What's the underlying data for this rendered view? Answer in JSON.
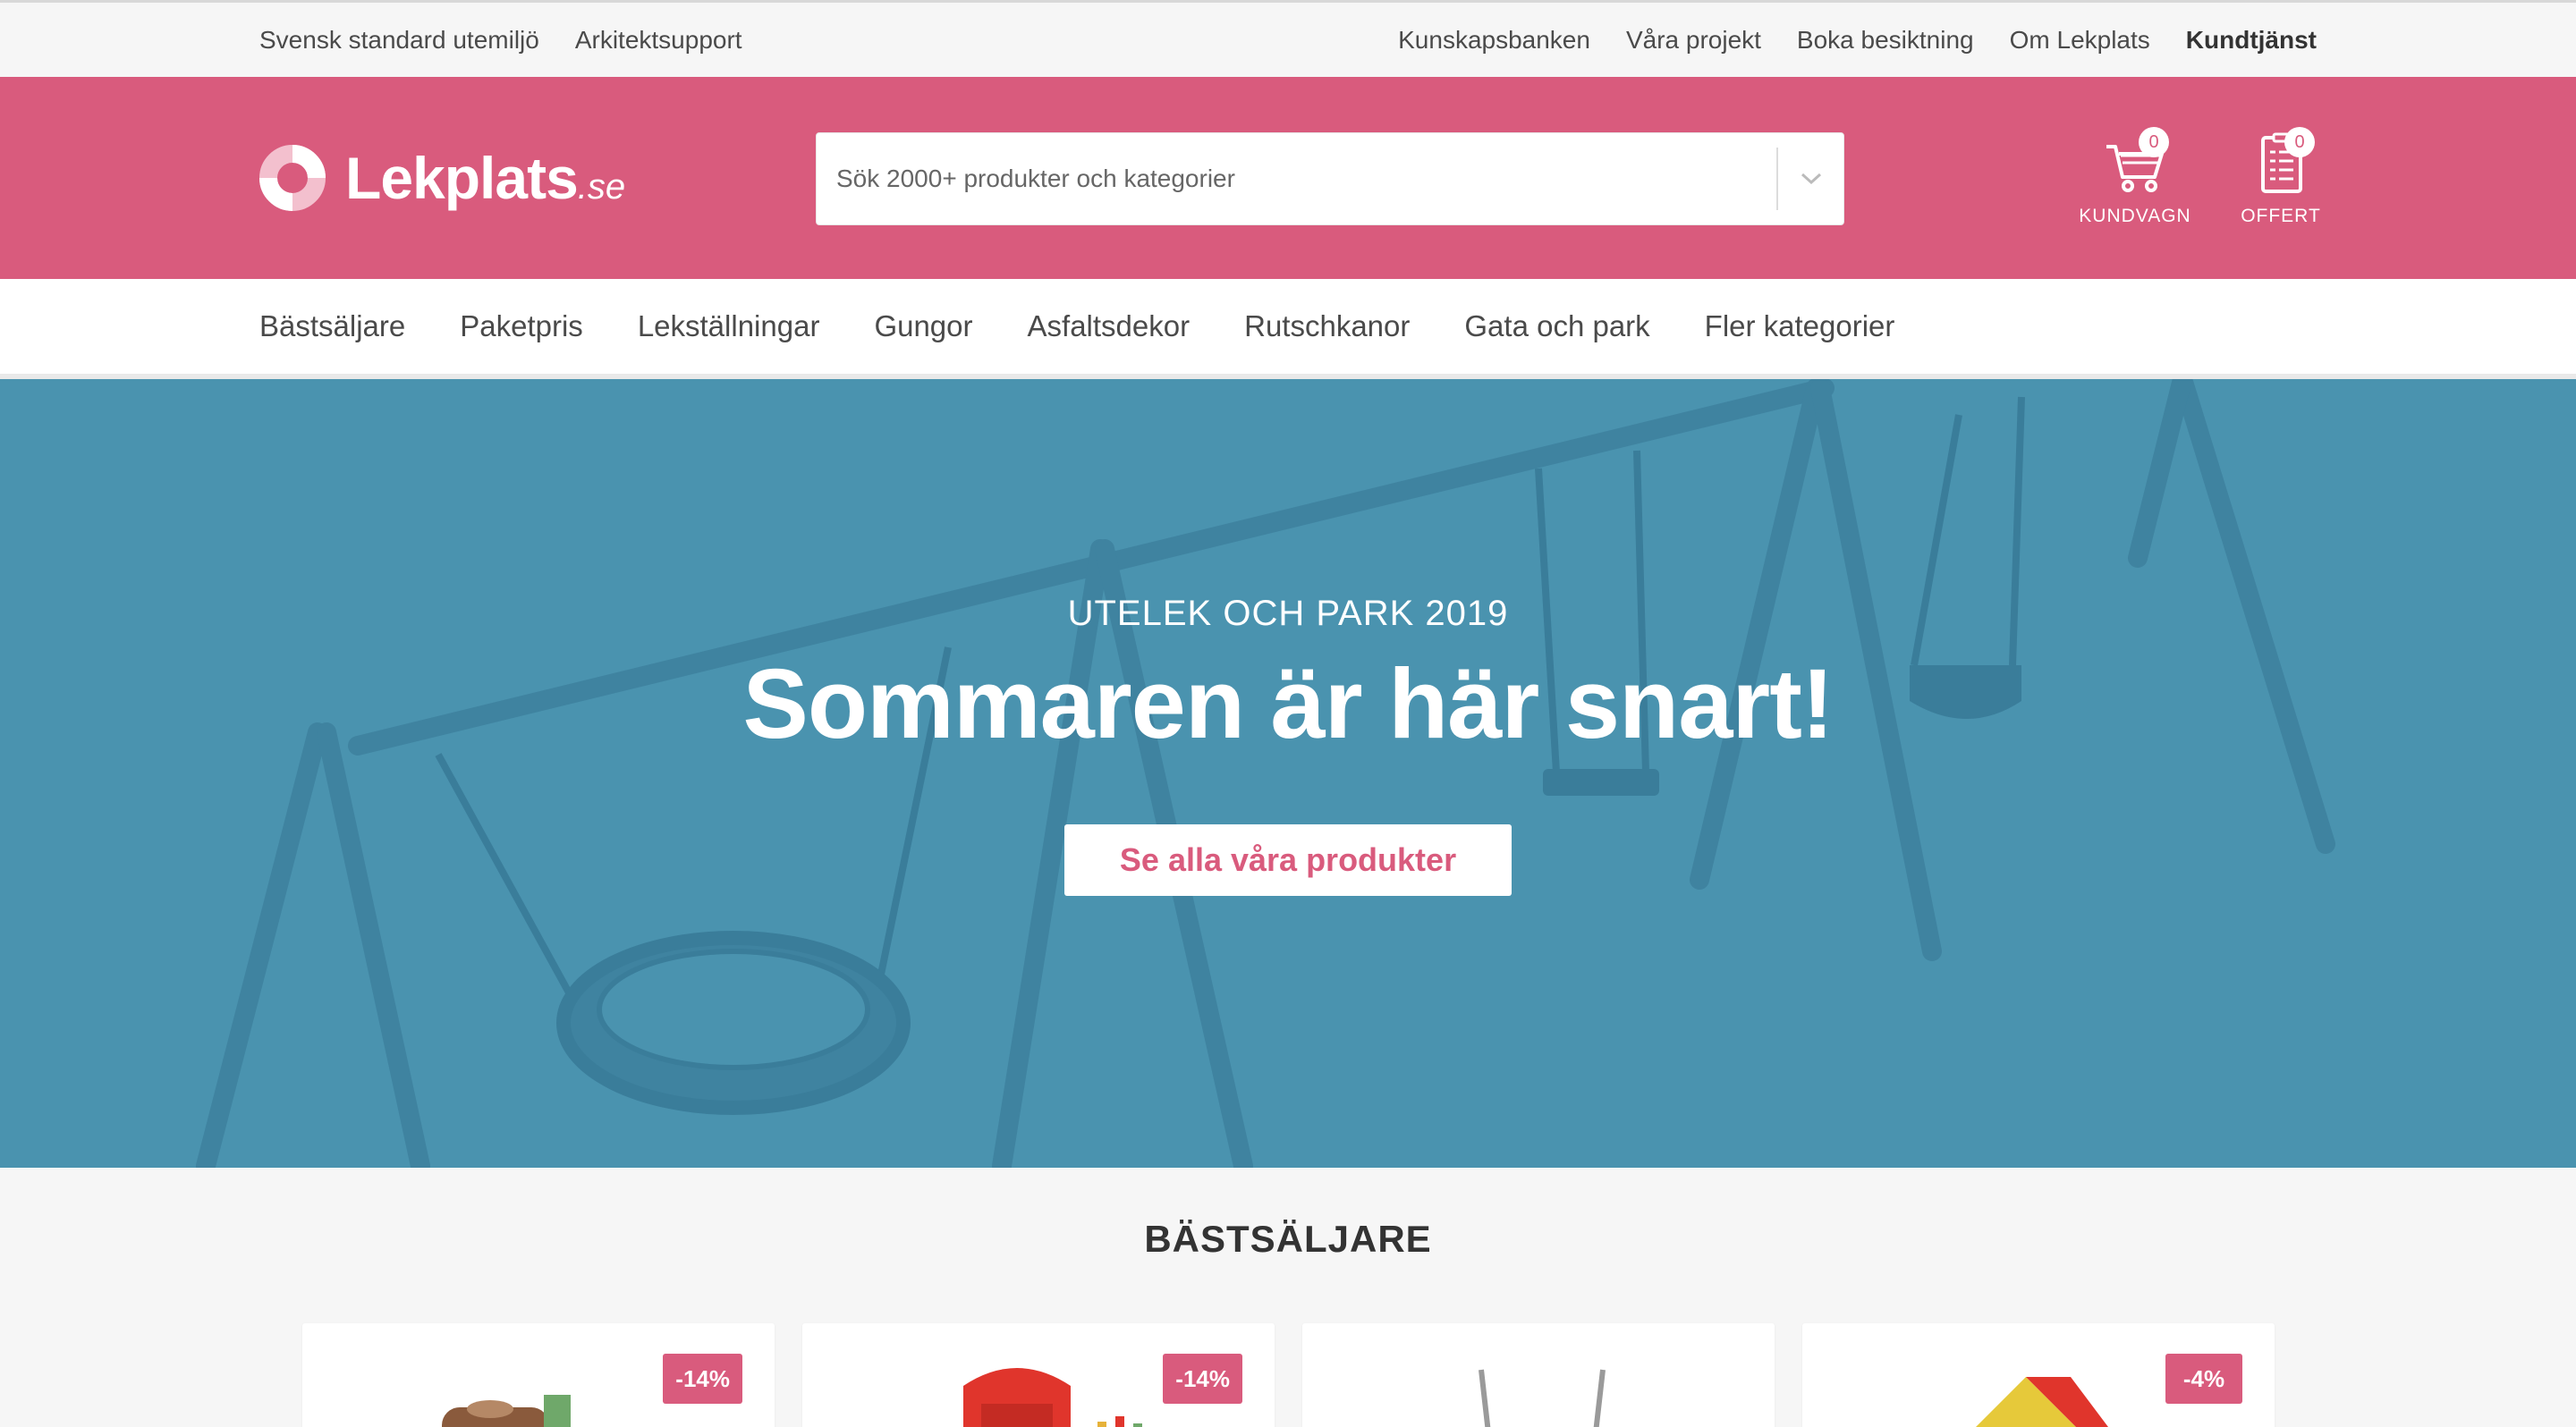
{
  "topbar": {
    "left_links": [
      "Svensk standard utemiljö",
      "Arkitektsupport"
    ],
    "right_links": [
      "Kunskapsbanken",
      "Våra projekt",
      "Boka besiktning",
      "Om Lekplats"
    ],
    "customer_service": "Kundtjänst"
  },
  "header": {
    "logo_main": "Lekplats",
    "logo_suffix": ".se",
    "search_placeholder": "Sök 2000+ produkter och kategorier",
    "cart": {
      "label": "KUNDVAGN",
      "count": "0",
      "icon": "cart-icon"
    },
    "offer": {
      "label": "OFFERT",
      "count": "0",
      "icon": "clipboard-icon"
    },
    "brand_color": "#d95b7d"
  },
  "nav": {
    "items": [
      "Bästsäljare",
      "Paketpris",
      "Lekställningar",
      "Gungor",
      "Asfaltsdekor",
      "Rutschkanor",
      "Gata och park",
      "Fler kategorier"
    ]
  },
  "hero": {
    "kicker": "UTELEK OCH PARK 2019",
    "headline": "Sommaren är här snart!",
    "cta": "Se alla våra produkter",
    "background_color": "#4a93af"
  },
  "bestsellers": {
    "title": "BÄSTSÄLJARE",
    "products": [
      {
        "discount": "-14%"
      },
      {
        "discount": "-14%"
      },
      {
        "discount": ""
      },
      {
        "discount": "-4%"
      }
    ]
  }
}
